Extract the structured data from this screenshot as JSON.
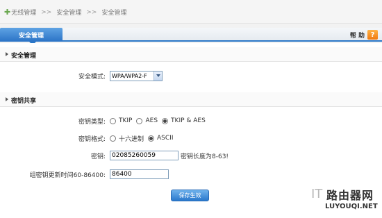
{
  "breadcrumb": {
    "items": [
      "无线管理",
      "安全管理",
      "安全管理"
    ],
    "separator": ">>"
  },
  "tab": {
    "label": "安全管理"
  },
  "help": {
    "label": "帮 助",
    "icon_text": "?"
  },
  "security_section": {
    "title": "安全管理",
    "mode_label": "安全模式:",
    "mode_value": "WPA/WPA2-F"
  },
  "key_section": {
    "title": "密钥共享",
    "type_label": "密钥类型:",
    "type_options": [
      "TKIP",
      "AES",
      "TKIP & AES"
    ],
    "type_selected": 2,
    "format_label": "密钥格式:",
    "format_options": [
      "十六进制",
      "ASCII"
    ],
    "format_selected": 1,
    "key_label": "密钥:",
    "key_value": "02085260059",
    "key_hint": "密钥长度为8-63!",
    "renew_label": "组密钥更新时间60-86400:",
    "renew_value": "86400"
  },
  "save_button": {
    "label": "保存生效"
  },
  "watermark": {
    "it": "IT",
    "cn": "路由器网",
    "en": "LUYOUQI.NET"
  },
  "colors": {
    "accent": "#2a77c7",
    "help_icon": "#f07a10"
  }
}
